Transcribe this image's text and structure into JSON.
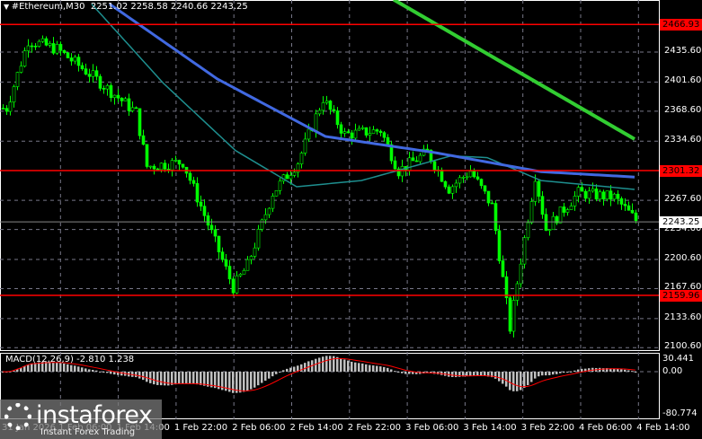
{
  "header": {
    "symbol": "#Ethereum,M30",
    "ohlc": "2251.02 2258.58 2240.66 2243.25"
  },
  "price_axis": [
    "2435.60",
    "2401.60",
    "2368.60",
    "2334.60",
    "2267.60",
    "2234.60",
    "2200.60",
    "2167.60",
    "2133.60",
    "2100.60"
  ],
  "levels": [
    {
      "label": "2466.93",
      "price": 2466.93
    },
    {
      "label": "2301.32",
      "price": 2301.32
    },
    {
      "label": "2159.96",
      "price": 2159.96
    }
  ],
  "current_price": {
    "label": "2243.25",
    "price": 2243.25
  },
  "macd": {
    "label": "MACD(12,26,9) -2.810 1.238",
    "max": "30.441",
    "zero": "0.00",
    "min": "-80.774"
  },
  "time_axis": [
    "31 Jan 2026",
    "1 Feb 06:00",
    "1 Feb 14:00",
    "1 Feb 22:00",
    "2 Feb 06:00",
    "2 Feb 14:00",
    "2 Feb 22:00",
    "3 Feb 06:00",
    "3 Feb 14:00",
    "3 Feb 22:00",
    "4 Feb 06:00",
    "4 Feb 14:00"
  ],
  "logo": {
    "name": "instaforex",
    "tagline": "Instant Forex Trading"
  },
  "colors": {
    "bull": "#00ff00",
    "bear": "#00ff00",
    "level": "#ff0000",
    "ma_blue": "#4169e1",
    "ma_teal": "#1e8f8f",
    "ma_green": "#32cd32"
  },
  "chart_data": {
    "type": "candlestick",
    "path_index": [
      1,
      7,
      15,
      25,
      37,
      40,
      50,
      55,
      64,
      68,
      75,
      82,
      89,
      95,
      105,
      110,
      118,
      124,
      130,
      136,
      141,
      144,
      148,
      151,
      160,
      170,
      176
    ],
    "path_price": [
      2372,
      2449,
      2439,
      2408,
      2367,
      2306,
      2311,
      2261,
      2169,
      2194,
      2276,
      2311,
      2383,
      2342,
      2347,
      2301,
      2322,
      2281,
      2301,
      2261,
      2123,
      2200,
      2296,
      2235,
      2276,
      2271,
      2245
    ],
    "ma_blue": {
      "index": [
        30,
        60,
        90,
        120,
        150,
        176
      ],
      "price": [
        2490,
        2405,
        2340,
        2322,
        2300,
        2294
      ]
    },
    "ma_teal": {
      "index": [
        25,
        45,
        65,
        82,
        100,
        125,
        135,
        150,
        176
      ],
      "price": [
        2490,
        2400,
        2324,
        2283,
        2290,
        2318,
        2316,
        2290,
        2280
      ]
    },
    "ma_green": {
      "index": [
        109,
        176
      ],
      "price": [
        2495,
        2337
      ]
    },
    "ylim": [
      2100.6,
      2480
    ]
  }
}
